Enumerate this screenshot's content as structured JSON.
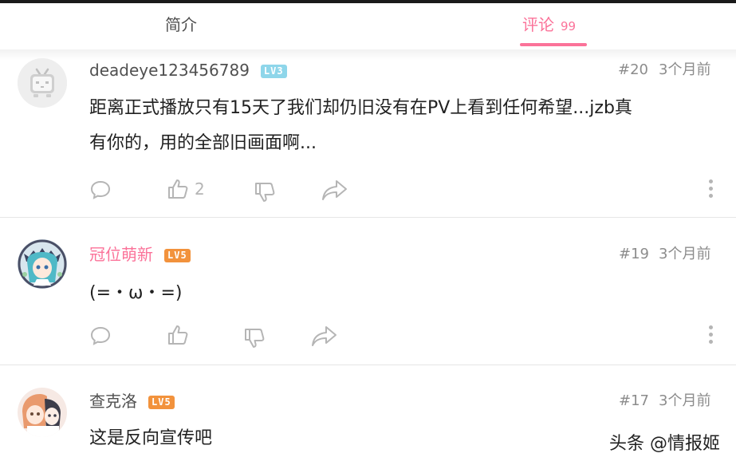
{
  "tabs": {
    "intro_label": "简介",
    "comments_label": "评论",
    "comments_count": "99"
  },
  "comments": [
    {
      "username": "deadeye123456789",
      "level": "LV3",
      "floor": "#20",
      "time": "3个月前",
      "text_line1": "距离正式播放只有15天了我们却仍旧没有在PV上看到任何希望...jzb真",
      "text_line2": "有你的，用的全部旧画面啊...",
      "likes": "2"
    },
    {
      "username": "冠位萌新",
      "level": "LV5",
      "floor": "#19",
      "time": "3个月前",
      "text_line1": "(=・ω・=)",
      "likes": ""
    },
    {
      "username": "查克洛",
      "level": "LV5",
      "floor": "#17",
      "time": "3个月前",
      "text_line1": "这是反向宣传吧"
    }
  ],
  "watermark": "头条 @情报姬",
  "colors": {
    "accent": "#fb7299",
    "lv3": "#8ed6ea",
    "lv5": "#f2923c",
    "icon": "#b5b5b5"
  }
}
